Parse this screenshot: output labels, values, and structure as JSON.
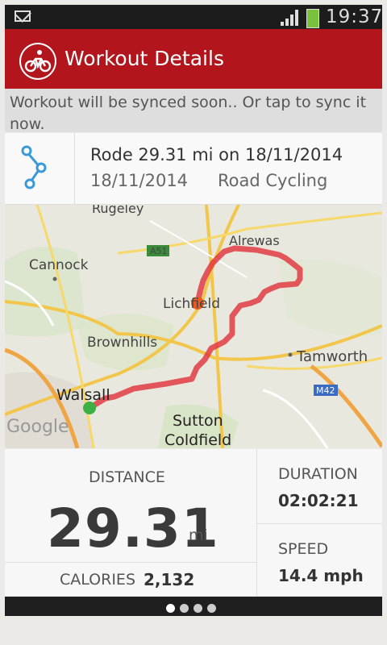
{
  "status_bar": {
    "time": "19:37"
  },
  "header": {
    "title": "Workout Details"
  },
  "sync_message": "Workout will be synced soon.. Or tap to sync it now.",
  "workout": {
    "title": "Rode 29.31 mi on 18/11/2014",
    "date": "18/11/2014",
    "activity": "Road Cycling"
  },
  "map": {
    "labels": {
      "rugeley": "Rugeley",
      "a51": "A51",
      "alrewas": "Alrewas",
      "cannock": "Cannock",
      "lichfield": "Lichfield",
      "brownhills": "Brownhills",
      "tamworth": "Tamworth",
      "m42": "M42",
      "walsall": "Walsall",
      "sutton": "Sutton",
      "coldfield": "Coldfield",
      "google": "Google"
    },
    "colors": {
      "route": "#e0313a",
      "start": "#3cb043",
      "end": "#f05a22"
    }
  },
  "stats": {
    "distance_label": "DISTANCE",
    "distance_value": "29.31",
    "distance_unit": "mi",
    "calories_label": "CALORIES",
    "calories_value": "2,132",
    "duration_label": "DURATION",
    "duration_value": "02:02:21",
    "speed_label": "SPEED",
    "speed_value": "14.4 mph"
  },
  "pager": {
    "active_index": 0,
    "count": 4
  },
  "colors": {
    "header": "#b2161c",
    "accent_icon": "#3a9ad9"
  }
}
